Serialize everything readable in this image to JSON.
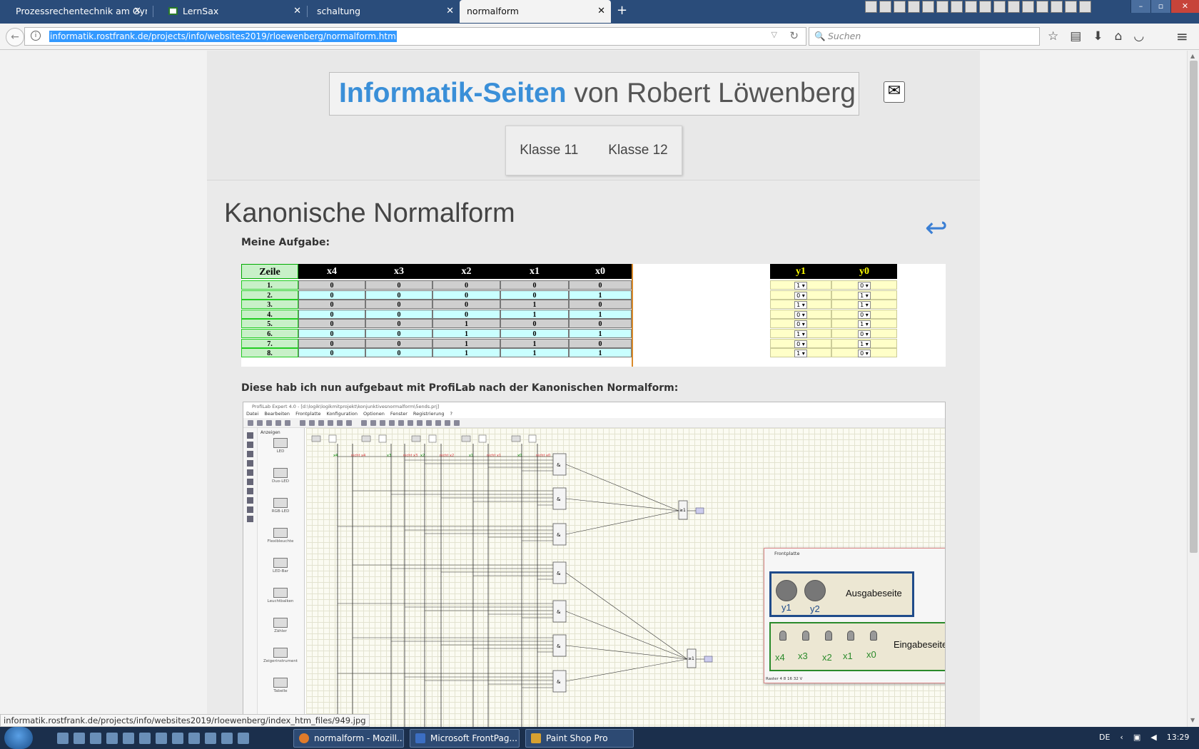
{
  "browser": {
    "tabs": [
      {
        "label": "Prozessrechentechnik am Gym..."
      },
      {
        "label": "LernSax"
      },
      {
        "label": "schaltung"
      },
      {
        "label": "normalform"
      }
    ],
    "new_tab": "+",
    "url": "informatik.rostfrank.de/projects/info/websites2019/rloewenberg/normalform.htm",
    "search_placeholder": "Suchen"
  },
  "site": {
    "title_bold": "Informatik-Seiten",
    "title_rest": " von Robert Löwenberg",
    "nav": [
      "Klasse 11",
      "Klasse 12"
    ]
  },
  "content": {
    "heading": "Kanonische Normalform",
    "task_label": "Meine Aufgabe:",
    "built_label": "Diese hab ich nun aufgebaut mit ProfiLab nach der Kanonischen Normalform:"
  },
  "truth_table": {
    "headers": [
      "Zeile",
      "x4",
      "x3",
      "x2",
      "x1",
      "x0"
    ],
    "out_headers": [
      "y1",
      "y0"
    ],
    "rows": [
      {
        "zeile": "1.",
        "x": [
          "0",
          "0",
          "0",
          "0",
          "0"
        ],
        "y1": "1",
        "y0": "0"
      },
      {
        "zeile": "2.",
        "x": [
          "0",
          "0",
          "0",
          "0",
          "1"
        ],
        "y1": "0",
        "y0": "1"
      },
      {
        "zeile": "3.",
        "x": [
          "0",
          "0",
          "0",
          "1",
          "0"
        ],
        "y1": "1",
        "y0": "1"
      },
      {
        "zeile": "4.",
        "x": [
          "0",
          "0",
          "0",
          "1",
          "1"
        ],
        "y1": "0",
        "y0": "0"
      },
      {
        "zeile": "5.",
        "x": [
          "0",
          "0",
          "1",
          "0",
          "0"
        ],
        "y1": "0",
        "y0": "1"
      },
      {
        "zeile": "6.",
        "x": [
          "0",
          "0",
          "1",
          "0",
          "1"
        ],
        "y1": "1",
        "y0": "0"
      },
      {
        "zeile": "7.",
        "x": [
          "0",
          "0",
          "1",
          "1",
          "0"
        ],
        "y1": "0",
        "y0": "1"
      },
      {
        "zeile": "8.",
        "x": [
          "0",
          "0",
          "1",
          "1",
          "1"
        ],
        "y1": "1",
        "y0": "0"
      }
    ]
  },
  "profilab": {
    "window_title": "ProfiLab Expert 4.0 - [d:\\logik\\logikmitprojekt\\konjunktivesnormalform\\5ends.prj]",
    "menu": [
      "Datei",
      "Bearbeiten",
      "Frontplatte",
      "Konfiguration",
      "Optionen",
      "Fenster",
      "Registrierung",
      "?"
    ],
    "palette_header": "Anzeigen",
    "palette_items": [
      "LED",
      "Duo-LED",
      "RGB-LED",
      "Flexibleuchte",
      "LED-Bar",
      "Leuchtbalken",
      "Zähler",
      "Zeigerinstrument",
      "Tabelle"
    ],
    "inputs": [
      "x4",
      "nicht x4",
      "x3",
      "nicht x3",
      "x2",
      "nicht x2",
      "x1",
      "nicht x1",
      "x0",
      "nicht x0"
    ],
    "gate_and": "&",
    "gate_or": "≥1",
    "frontplatte": {
      "title": "Frontplatte",
      "out_title": "Ausgabeseite",
      "outputs": [
        "y1",
        "y2"
      ],
      "in_title": "Eingabeseite",
      "inputs": [
        "x4",
        "x3",
        "x2",
        "x1",
        "x0"
      ],
      "status": "Raster   4   8   16   32   V"
    }
  },
  "status_url": "informatik.rostfrank.de/projects/info/websites2019/rloewenberg/index_htm_files/949.jpg",
  "taskbar": {
    "buttons": [
      "normalform - Mozill...",
      "Microsoft FrontPag...",
      "Paint Shop Pro"
    ],
    "lang": "DE",
    "time": "13:29"
  }
}
